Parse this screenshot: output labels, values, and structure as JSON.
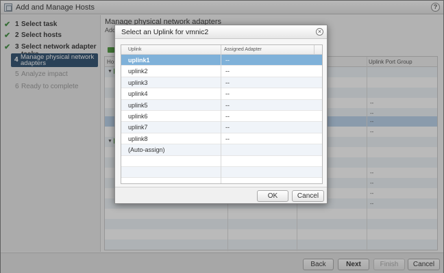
{
  "window": {
    "title": "Add and Manage Hosts",
    "help_icon": "question-mark-icon"
  },
  "steps": [
    {
      "num": "1",
      "label": "Select task",
      "state": "done"
    },
    {
      "num": "2",
      "label": "Select hosts",
      "state": "done"
    },
    {
      "num": "3",
      "label": "Select network adapter tasks",
      "state": "done"
    },
    {
      "num": "4",
      "label_line1": "Manage physical network",
      "label_line2": "adapters",
      "state": "active"
    },
    {
      "num": "5",
      "label": "Analyze impact",
      "state": "disabled"
    },
    {
      "num": "6",
      "label": "Ready to complete",
      "state": "disabled"
    }
  ],
  "content": {
    "title": "Manage physical network adapters",
    "subtitle": "Add",
    "grid_header_host": "Host",
    "grid_header_uplink_port_group": "Uplink Port Group",
    "dash": "--"
  },
  "dialog": {
    "title": "Select an Uplink for vmnic2",
    "columns": {
      "uplink": "Uplink",
      "assigned_adapter": "Assigned Adapter"
    },
    "rows": [
      {
        "uplink": "uplink1",
        "adapter": "--",
        "selected": true
      },
      {
        "uplink": "uplink2",
        "adapter": "--"
      },
      {
        "uplink": "uplink3",
        "adapter": "--"
      },
      {
        "uplink": "uplink4",
        "adapter": "--"
      },
      {
        "uplink": "uplink5",
        "adapter": "--"
      },
      {
        "uplink": "uplink6",
        "adapter": "--"
      },
      {
        "uplink": "uplink7",
        "adapter": "--"
      },
      {
        "uplink": "uplink8",
        "adapter": "--"
      },
      {
        "uplink": "(Auto-assign)",
        "adapter": ""
      },
      {
        "uplink": "",
        "adapter": ""
      },
      {
        "uplink": "",
        "adapter": ""
      }
    ],
    "ok_label": "OK",
    "cancel_label": "Cancel"
  },
  "footer": {
    "back_label": "Back",
    "next_label": "Next",
    "finish_label": "Finish",
    "cancel_label": "Cancel"
  },
  "colors": {
    "active_step": "#2b4d6e",
    "selected_row": "#7fb1d9",
    "check": "#3e8e3e"
  }
}
